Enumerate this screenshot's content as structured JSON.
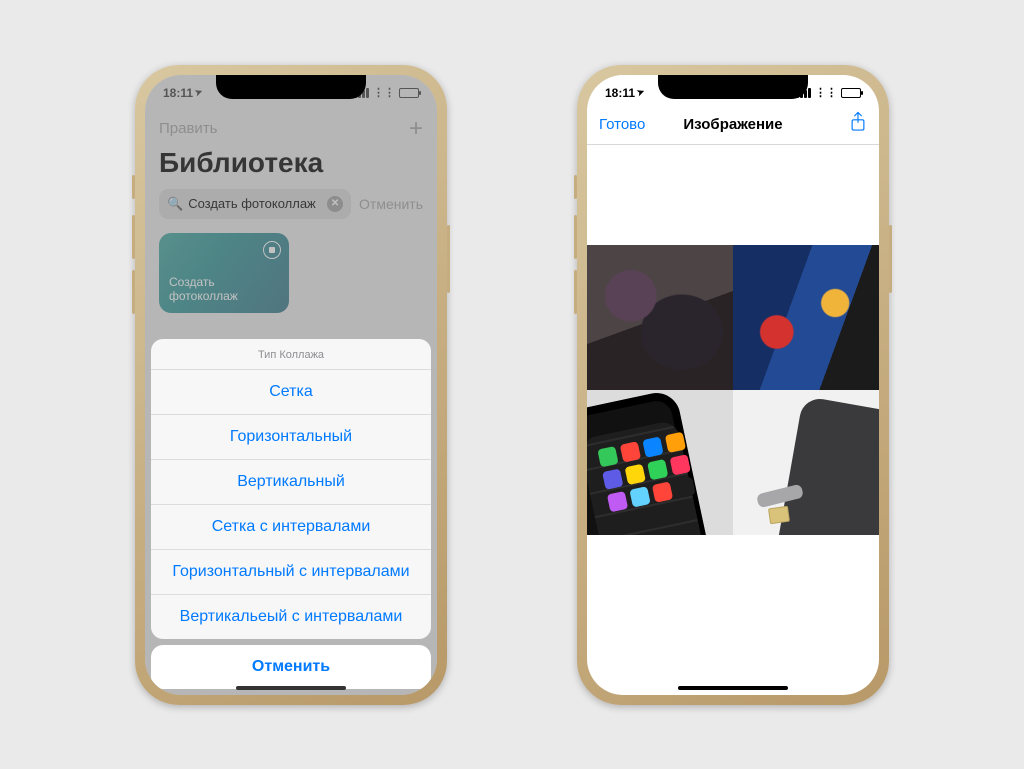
{
  "status": {
    "time": "18:11",
    "location_glyph": "➤"
  },
  "left_phone": {
    "toolbar": {
      "edit_label": "Править"
    },
    "library_title": "Библиотека",
    "search": {
      "value": "Создать фотоколлаж",
      "cancel_label": "Отменить"
    },
    "tile": {
      "title": "Создать фотоколлаж"
    },
    "action_sheet": {
      "title": "Тип Коллажа",
      "options": [
        "Сетка",
        "Горизонтальный",
        "Вертикальный",
        "Сетка с интервалами",
        "Горизонтальный с интервалами",
        "Вертикальеый с интервалами"
      ],
      "cancel_label": "Отменить"
    }
  },
  "right_phone": {
    "nav": {
      "done_label": "Готово",
      "title": "Изображение"
    }
  }
}
